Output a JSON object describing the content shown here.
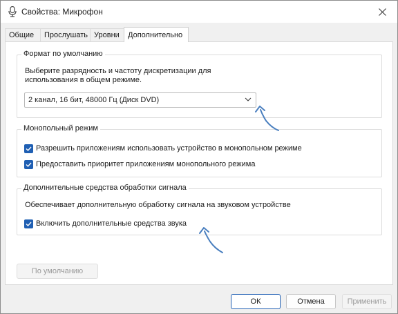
{
  "window": {
    "title": "Свойства: Микрофон",
    "icon": "microphone-icon"
  },
  "tabs": [
    {
      "label": "Общие",
      "active": false
    },
    {
      "label": "Прослушать",
      "active": false
    },
    {
      "label": "Уровни",
      "active": false
    },
    {
      "label": "Дополнительно",
      "active": true
    }
  ],
  "default_format": {
    "legend": "Формат по умолчанию",
    "description_line1": "Выберите разрядность и частоту дискретизации для",
    "description_line2": "использования в общем режиме.",
    "selected_value": "2 канал, 16 бит, 48000 Гц (Диск DVD)"
  },
  "exclusive_mode": {
    "legend": "Монопольный режим",
    "options": [
      {
        "label": "Разрешить приложениям использовать устройство в монопольном режиме",
        "checked": true
      },
      {
        "label": "Предоставить приоритет приложениям монопольного режима",
        "checked": true
      }
    ]
  },
  "signal_enhancements": {
    "legend": "Дополнительные средства обработки сигнала",
    "description": "Обеспечивает дополнительную обработку сигнала на звуковом устройстве",
    "option": {
      "label": "Включить дополнительные средства звука",
      "checked": true
    }
  },
  "buttons": {
    "restore_default": "По умолчанию",
    "ok": "ОК",
    "cancel": "Отмена",
    "apply": "Применить"
  },
  "colors": {
    "accent": "#1f5fb3",
    "arrow": "#4a7fbf"
  }
}
